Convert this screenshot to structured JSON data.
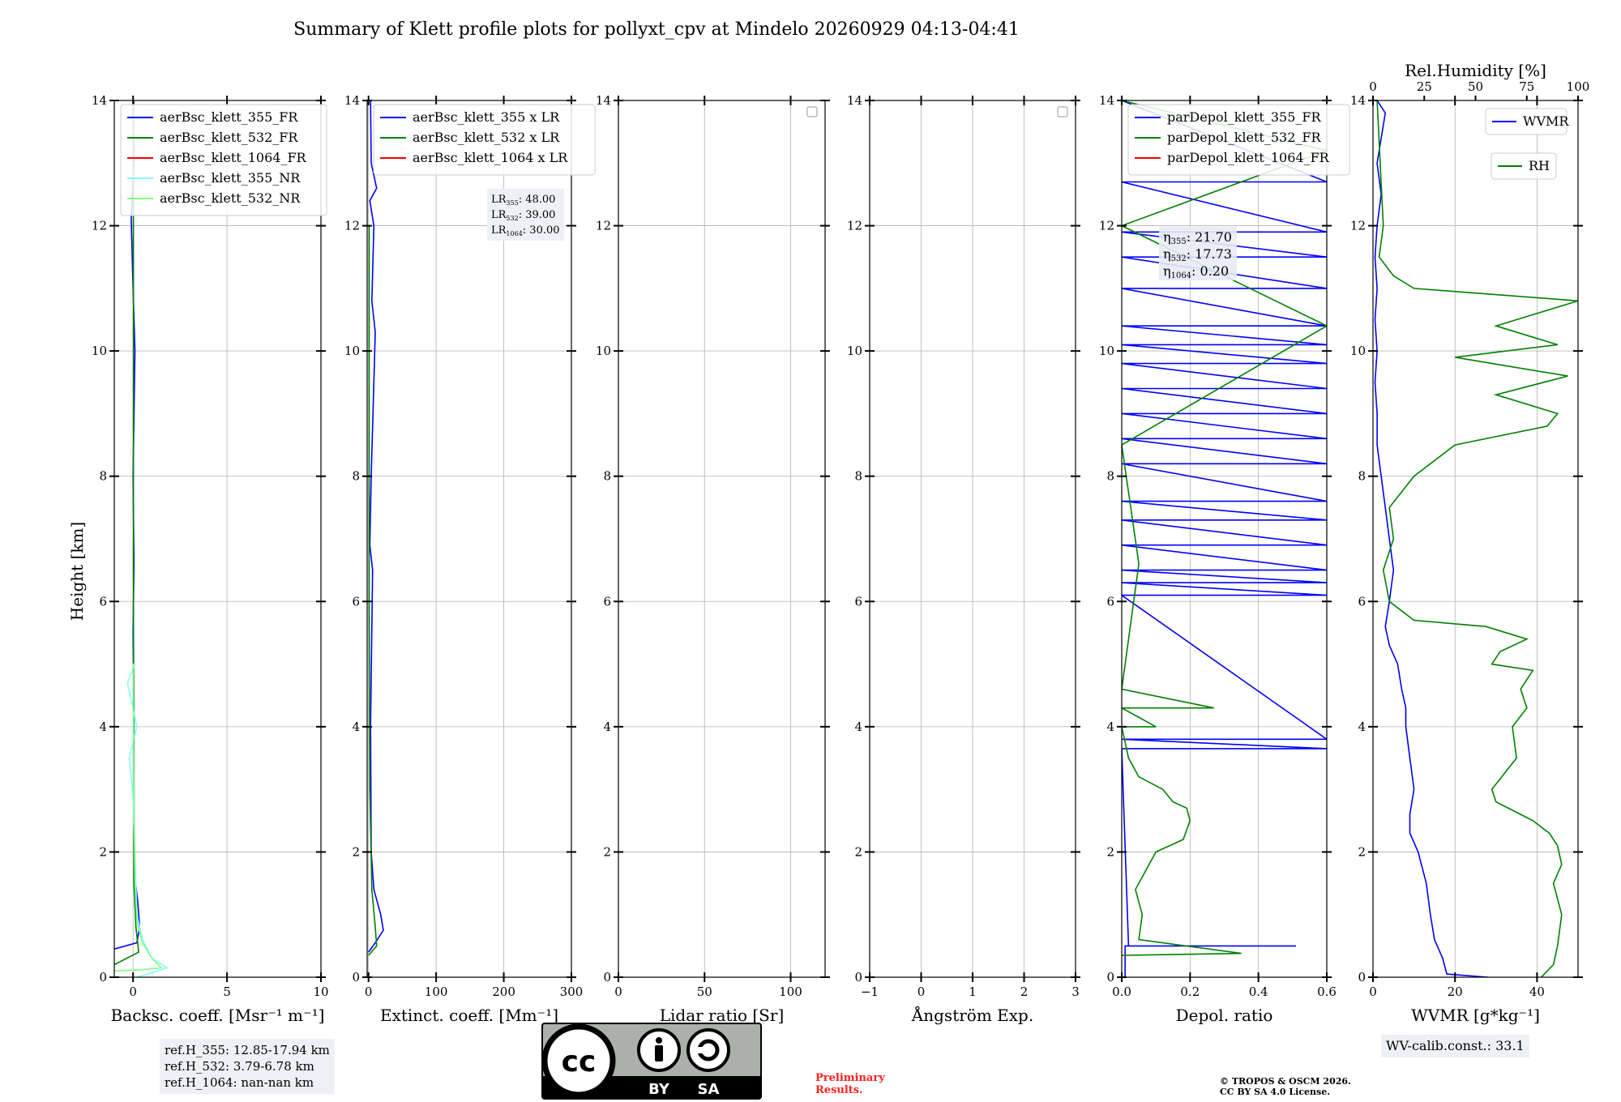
{
  "title": "Summary of Klett profile plots for pollyxt_cpv at Mindelo 20260929 04:13-04:41",
  "ylabel": "Height [km]",
  "colors": {
    "b355": "#0000ff",
    "g532": "#008000",
    "r1064": "#ff0000",
    "c355nr": "#80ffff",
    "lg532nr": "#80ff80"
  },
  "chart_data": [
    {
      "type": "line",
      "id": "bsc",
      "xlabel": "Backsc. coeff. [Msr⁻¹ m⁻¹]",
      "xlim": [
        -1,
        10
      ],
      "ylim": [
        0,
        14
      ],
      "xticks": [
        0,
        5,
        10
      ],
      "xticklabels": [
        "0",
        "5",
        "10"
      ],
      "yticks": [
        0,
        2,
        4,
        6,
        8,
        10,
        12,
        14
      ],
      "legend": [
        "aerBsc_klett_355_FR",
        "aerBsc_klett_532_FR",
        "aerBsc_klett_1064_FR",
        "aerBsc_klett_355_NR",
        "aerBsc_klett_532_NR"
      ],
      "series": [
        {
          "name": "aerBsc_klett_355_FR",
          "color": "#0000ff",
          "x": [
            -1.0,
            0.2,
            0.35,
            0.25,
            0.1,
            0.05,
            0.05,
            0.0,
            0.05,
            0.0,
            0.1,
            0.0,
            -0.1,
            0.05,
            0.0,
            0.05
          ],
          "y": [
            0.45,
            0.55,
            0.8,
            1.2,
            1.6,
            2.5,
            4.0,
            5.5,
            6.6,
            8.0,
            10.0,
            11.0,
            12.1,
            13.0,
            13.8,
            14.0
          ]
        },
        {
          "name": "aerBsc_klett_532_FR",
          "color": "#008000",
          "x": [
            -1.0,
            0.3,
            0.15,
            0.05,
            0.05,
            0.02,
            0.02
          ],
          "y": [
            0.2,
            0.4,
            0.8,
            1.5,
            3.0,
            6.0,
            14.0
          ]
        },
        {
          "name": "aerBsc_klett_355_NR",
          "color": "#80ffff",
          "x": [
            0.2,
            0.8,
            1.3,
            1.8,
            1.0,
            0.5,
            0.2,
            0.1,
            0.0,
            -0.2,
            0.2,
            0.0,
            -0.3,
            0.1,
            0.0
          ],
          "y": [
            0.0,
            0.05,
            0.1,
            0.15,
            0.3,
            0.6,
            1.0,
            2.0,
            2.9,
            3.5,
            4.0,
            4.3,
            4.7,
            5.0,
            5.0
          ]
        },
        {
          "name": "aerBsc_klett_532_NR",
          "color": "#80ff80",
          "x": [
            -1.0,
            0.5,
            1.5,
            1.0,
            0.5,
            0.2,
            0.1,
            0.05,
            0.0
          ],
          "y": [
            0.1,
            0.12,
            0.15,
            0.3,
            0.55,
            0.9,
            1.5,
            3.0,
            5.0
          ]
        }
      ]
    },
    {
      "type": "line",
      "id": "ext",
      "xlabel": "Extinct. coeff. [Mm⁻¹]",
      "xlim": [
        -2,
        300
      ],
      "ylim": [
        0,
        14
      ],
      "xticks": [
        0,
        100,
        200,
        300
      ],
      "xticklabels": [
        "0",
        "100",
        "200",
        "300"
      ],
      "yticks": [
        0,
        2,
        4,
        6,
        8,
        10,
        12,
        14
      ],
      "legend": [
        "aerBsc_klett_355 x LR",
        "aerBsc_klett_532 x LR",
        "aerBsc_klett_1064 x LR"
      ],
      "lr_box": [
        [
          "LR",
          "355",
          ": 48.00"
        ],
        [
          "LR",
          "532",
          ": 39.00"
        ],
        [
          "LR",
          "1064",
          ": 30.00"
        ]
      ],
      "series": [
        {
          "name": "aerBsc_klett_355 x LR",
          "color": "#0000ff",
          "x": [
            0,
            10,
            22,
            18,
            8,
            4,
            3,
            6,
            2,
            4,
            10,
            5,
            8,
            2,
            12,
            4,
            3
          ],
          "y": [
            0.4,
            0.55,
            0.75,
            1.0,
            1.4,
            2.0,
            4.0,
            6.5,
            6.9,
            8.0,
            10.3,
            10.8,
            12.0,
            12.4,
            12.6,
            13.0,
            14.0
          ]
        },
        {
          "name": "aerBsc_klett_532 x LR",
          "color": "#008000",
          "x": [
            0,
            12,
            10,
            5,
            2,
            1,
            1
          ],
          "y": [
            0.35,
            0.5,
            0.8,
            1.4,
            3.0,
            6.0,
            12.0
          ]
        }
      ]
    },
    {
      "type": "line",
      "id": "lr",
      "xlabel": "Lidar ratio [Sr]",
      "xlim": [
        0,
        120
      ],
      "ylim": [
        0,
        14
      ],
      "xticks": [
        0,
        50,
        100
      ],
      "xticklabels": [
        "0",
        "50",
        "100"
      ],
      "yticks": [
        0,
        2,
        4,
        6,
        8,
        10,
        12,
        14
      ],
      "series": []
    },
    {
      "type": "line",
      "id": "ang",
      "xlabel": "Ångström Exp.",
      "xlim": [
        -1,
        3
      ],
      "ylim": [
        0,
        14
      ],
      "xticks": [
        -1,
        0,
        1,
        2,
        3
      ],
      "xticklabels": [
        "−1",
        "0",
        "1",
        "2",
        "3"
      ],
      "yticks": [
        0,
        2,
        4,
        6,
        8,
        10,
        12,
        14
      ],
      "series": []
    },
    {
      "type": "line",
      "id": "dep",
      "xlabel": "Depol. ratio",
      "xlim": [
        0,
        0.6
      ],
      "ylim": [
        0,
        14
      ],
      "xticks": [
        0,
        0.2,
        0.4,
        0.6
      ],
      "xticklabels": [
        "0.0",
        "0.2",
        "0.4",
        "0.6"
      ],
      "yticks": [
        0,
        2,
        4,
        6,
        8,
        10,
        12,
        14
      ],
      "legend": [
        "parDepol_klett_355_FR",
        "parDepol_klett_532_FR",
        "parDepol_klett_1064_FR"
      ],
      "eta_box": [
        [
          "η",
          "355",
          ": 21.70"
        ],
        [
          "η",
          "532",
          ": 17.73"
        ],
        [
          "η",
          "1064",
          ": 0.20"
        ]
      ],
      "series": [
        {
          "name": "parDepol_klett_355_FR",
          "color": "#0000ff",
          "x": [
            0.01,
            0.01,
            0.51,
            0.02,
            0.0,
            0.6,
            0.0,
            0.6,
            0.0,
            0.6,
            0.0,
            0.6,
            0.0,
            0.6,
            0.0,
            0.6,
            0.0,
            0.6,
            0.0,
            0.6,
            0.0,
            0.6,
            0.0,
            0.6,
            0.0,
            0.6,
            0.0,
            0.6,
            0.0,
            0.6,
            0.0,
            0.6,
            0.0,
            0.6,
            0.0,
            0.6,
            0.0,
            0.6,
            0.0,
            0.6,
            0.0,
            0.6,
            0.0
          ],
          "y": [
            0.0,
            0.5,
            0.5,
            0.5,
            3.65,
            3.65,
            3.8,
            3.8,
            6.1,
            6.1,
            6.3,
            6.3,
            6.5,
            6.5,
            6.9,
            6.9,
            7.3,
            7.3,
            7.6,
            7.6,
            8.2,
            8.2,
            8.6,
            8.6,
            9.0,
            9.0,
            9.4,
            9.4,
            9.8,
            9.8,
            10.1,
            10.1,
            10.4,
            10.4,
            11.0,
            11.0,
            11.5,
            11.5,
            11.9,
            11.9,
            12.7,
            12.7,
            14.0
          ]
        },
        {
          "name": "parDepol_klett_532_FR",
          "color": "#008000",
          "x": [
            0.0,
            0.35,
            0.05,
            0.06,
            0.04,
            0.08,
            0.1,
            0.18,
            0.2,
            0.19,
            0.15,
            0.12,
            0.05,
            0.02,
            0.0,
            0.1,
            0.0,
            0.27,
            0.0,
            0.05,
            0.0,
            0.6,
            0.0,
            0.6,
            0.0
          ],
          "y": [
            0.35,
            0.38,
            0.6,
            1.0,
            1.4,
            1.8,
            2.0,
            2.2,
            2.5,
            2.7,
            2.8,
            3.0,
            3.2,
            3.5,
            4.0,
            4.0,
            4.3,
            4.3,
            4.6,
            6.6,
            8.5,
            10.4,
            12.0,
            13.2,
            14.0
          ]
        }
      ]
    },
    {
      "type": "line",
      "id": "wv",
      "xlabel": "WVMR [g*kg⁻¹]",
      "top_label": "Rel.Humidity [%]",
      "xlim": [
        0,
        50
      ],
      "ylim": [
        0,
        14
      ],
      "xticks": [
        0,
        20,
        40
      ],
      "xticklabels": [
        "0",
        "20",
        "40"
      ],
      "top_xlim": [
        0,
        100
      ],
      "top_xticks": [
        0,
        25,
        50,
        75,
        100
      ],
      "yticks": [
        0,
        2,
        4,
        6,
        8,
        10,
        12,
        14
      ],
      "legend": [
        "WVMR",
        "RH"
      ],
      "wv_calib": "WV-calib.const.: 33.1",
      "series": [
        {
          "name": "WVMR",
          "color": "#0000ff",
          "axis": "bottom",
          "x": [
            28,
            18,
            17,
            15,
            14,
            13,
            11,
            9,
            9,
            10,
            9,
            8,
            8,
            7,
            6,
            4,
            3,
            4,
            5,
            4,
            3,
            2,
            1,
            1,
            0.5,
            1,
            0.5,
            1,
            0.5,
            1,
            2,
            1,
            3,
            1
          ],
          "y": [
            0.0,
            0.05,
            0.3,
            0.6,
            1.0,
            1.5,
            2.0,
            2.3,
            2.6,
            3.0,
            3.5,
            4.0,
            4.3,
            4.6,
            5.0,
            5.3,
            5.6,
            6.0,
            6.5,
            7.0,
            7.5,
            8.0,
            8.5,
            9.0,
            9.5,
            10.0,
            10.5,
            11.0,
            11.5,
            12.0,
            12.5,
            13.0,
            13.8,
            14.0
          ]
        },
        {
          "name": "RH",
          "color": "#008000",
          "axis": "top",
          "x": [
            82,
            88,
            90,
            92,
            88,
            92,
            90,
            86,
            78,
            72,
            60,
            58,
            70,
            68,
            75,
            72,
            78,
            58,
            62,
            75,
            55,
            20,
            8,
            5,
            10,
            8,
            20,
            40,
            85,
            90,
            60,
            95,
            40,
            90,
            60,
            100,
            20,
            10,
            3,
            5,
            2
          ],
          "y": [
            0.0,
            0.2,
            0.5,
            1.0,
            1.5,
            1.8,
            2.1,
            2.3,
            2.5,
            2.6,
            2.8,
            3.0,
            3.5,
            4.0,
            4.3,
            4.6,
            4.9,
            5.0,
            5.2,
            5.4,
            5.6,
            5.7,
            6.0,
            6.5,
            7.0,
            7.5,
            8.0,
            8.5,
            8.8,
            9.0,
            9.3,
            9.6,
            9.9,
            10.1,
            10.4,
            10.8,
            11.0,
            11.2,
            11.5,
            12.0,
            14.0
          ]
        }
      ]
    }
  ],
  "refh": [
    "ref.H_355: 12.85-17.94 km",
    "ref.H_532: 3.79-6.78 km",
    "ref.H_1064: nan-nan km"
  ],
  "license_badge": {
    "by": "BY",
    "sa": "SA"
  },
  "preliminary": [
    "Preliminary",
    "Results."
  ],
  "copyright": [
    "© TROPOS & OSCM 2026.",
    "CC BY SA 4.0 License."
  ]
}
